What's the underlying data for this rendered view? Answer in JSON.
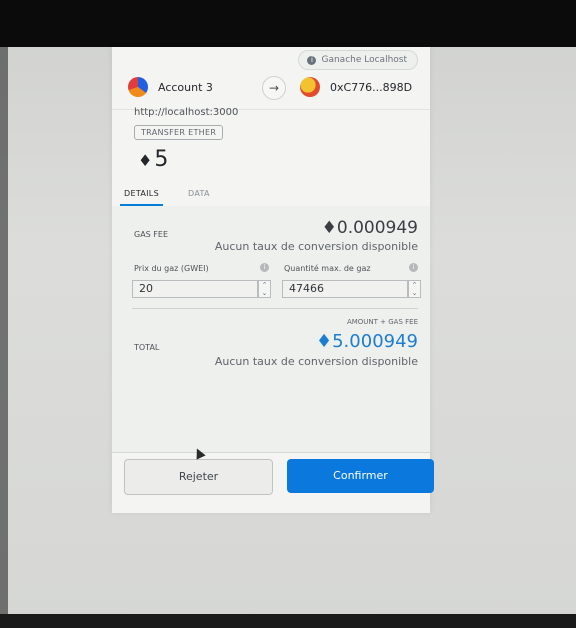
{
  "network": {
    "label": "Ganache Localhost",
    "icon": "info-icon"
  },
  "from_account": {
    "name": "Account 3"
  },
  "to_account": {
    "address": "0xC776...898D"
  },
  "origin": "http://localhost:3000",
  "method": "TRANSFER ETHER",
  "amount": {
    "symbol": "♦",
    "value": "5"
  },
  "tabs": {
    "details": "DETAILS",
    "data": "DATA"
  },
  "gas": {
    "label": "GAS FEE",
    "symbol": "♦",
    "value": "0.000949",
    "no_conversion": "Aucun taux de conversion disponible",
    "price_label": "Prix du gaz (GWEI)",
    "price_value": "20",
    "limit_label": "Quantité max. de gaz",
    "limit_value": "47466"
  },
  "total": {
    "amount_plus_gas_label": "AMOUNT + GAS FEE",
    "label": "TOTAL",
    "symbol": "♦",
    "value": "5.000949",
    "no_conversion": "Aucun taux de conversion disponible"
  },
  "buttons": {
    "reject": "Rejeter",
    "confirm": "Confirmer"
  },
  "colors": {
    "accent": "#0a78dc",
    "total_text": "#1c7ed0"
  }
}
